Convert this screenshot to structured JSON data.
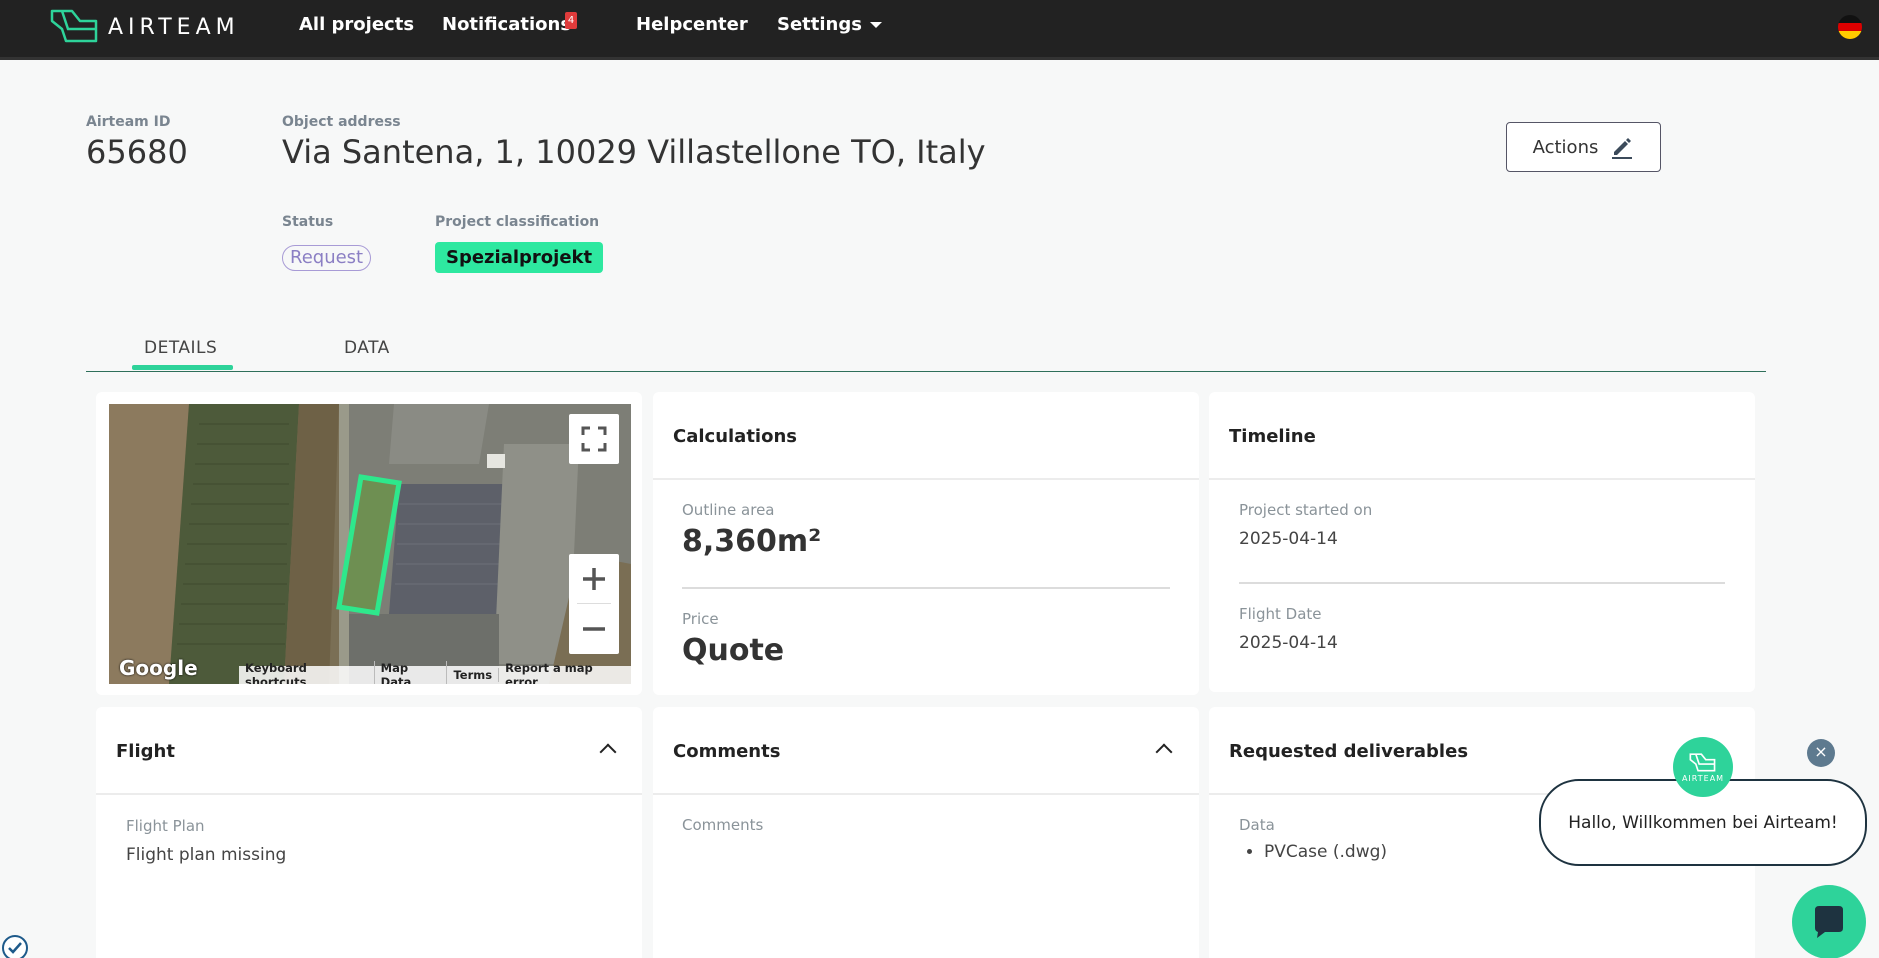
{
  "nav": {
    "brand": "AIRTEAM",
    "items": [
      "All projects",
      "Notifications",
      "Helpcenter",
      "Settings"
    ],
    "notification_count": "4"
  },
  "header": {
    "id_label": "Airteam ID",
    "id_value": "65680",
    "address_label": "Object address",
    "address_value": "Via Santena, 1, 10029 Villastellone TO, Italy",
    "status_label": "Status",
    "status_value": "Request",
    "classification_label": "Project classification",
    "classification_value": "Spezialprojekt",
    "actions_label": "Actions"
  },
  "tabs": [
    "DETAILS",
    "DATA"
  ],
  "map": {
    "attribution": "Google",
    "footer": [
      "Keyboard shortcuts",
      "Map Data",
      "Terms",
      "Report a map error"
    ]
  },
  "calculations": {
    "title": "Calculations",
    "area_label": "Outline area",
    "area_value": "8,360m²",
    "price_label": "Price",
    "price_value": "Quote"
  },
  "timeline": {
    "title": "Timeline",
    "started_label": "Project started on",
    "started_value": "2025-04-14",
    "flight_label": "Flight Date",
    "flight_value": "2025-04-14"
  },
  "flight": {
    "title": "Flight",
    "plan_label": "Flight Plan",
    "plan_value": "Flight plan missing"
  },
  "comments": {
    "title": "Comments",
    "label": "Comments"
  },
  "deliverables": {
    "title": "Requested deliverables",
    "data_label": "Data",
    "items": [
      "PVCase (.dwg)"
    ]
  },
  "chat": {
    "greeting": "Hallo, Willkommen bei Airteam!",
    "avatar_text": "AIRTEAM",
    "close": "×"
  },
  "colors": {
    "accent": "#2ed39a",
    "nav_bg": "#222222",
    "badge": "#e03b3b"
  }
}
